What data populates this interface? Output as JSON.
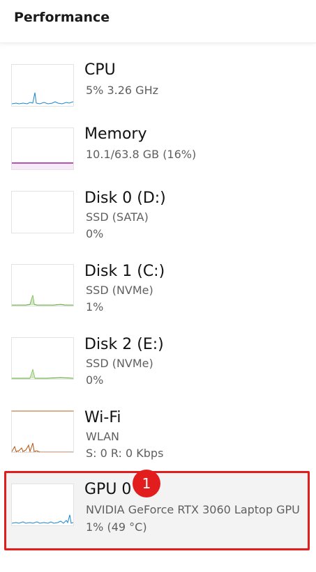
{
  "header": {
    "title": "Performance"
  },
  "items": [
    {
      "name": "CPU",
      "line1": "5%  3.26 GHz",
      "line2": "",
      "graph_color": "#1a86d0",
      "icon": "cpu-graph"
    },
    {
      "name": "Memory",
      "line1": "10.1/63.8 GB (16%)",
      "line2": "",
      "graph_color": "#9b1c9b",
      "icon": "memory-graph"
    },
    {
      "name": "Disk 0 (D:)",
      "line1": "SSD (SATA)",
      "line2": "0%",
      "graph_color": "#4ca020",
      "icon": "disk-graph"
    },
    {
      "name": "Disk 1 (C:)",
      "line1": "SSD (NVMe)",
      "line2": "1%",
      "graph_color": "#4ca020",
      "icon": "disk-graph"
    },
    {
      "name": "Disk 2 (E:)",
      "line1": "SSD (NVMe)",
      "line2": "0%",
      "graph_color": "#4ca020",
      "icon": "disk-graph"
    },
    {
      "name": "Wi-Fi",
      "line1": "WLAN",
      "line2": "S: 0  R: 0 Kbps",
      "graph_color": "#b0530f",
      "icon": "network-graph"
    },
    {
      "name": "GPU 0",
      "line1": "NVIDIA GeForce RTX 3060 Laptop GPU",
      "line2": "1%  (49 °C)",
      "graph_color": "#1a86d0",
      "icon": "gpu-graph",
      "selected": true
    }
  ],
  "annotation": {
    "badge_label": "1",
    "highlight_color": "#e11d1d"
  }
}
